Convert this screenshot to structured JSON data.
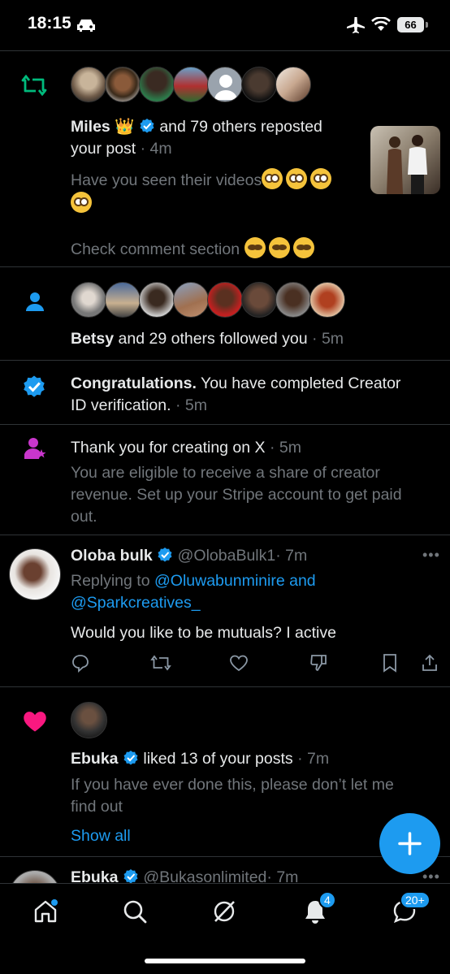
{
  "status_bar": {
    "time": "18:15",
    "battery": "66"
  },
  "notifications": {
    "repost": {
      "name": "Miles",
      "name_suffix": "👑",
      "action": "and 79 others reposted",
      "line2": "your post",
      "time": "· 4m",
      "snippet_line1": "Have you seen their videos",
      "snippet_line2": "Check comment section"
    },
    "follow": {
      "name": "Betsy",
      "action": "and 29 others followed you",
      "time": "· 5m"
    },
    "verification": {
      "title": "Congratulations.",
      "text_line1": " You have completed Creator",
      "text_line2": "ID verification.",
      "time": "· 5m"
    },
    "creator": {
      "title": "Thank you for creating on X",
      "time": "· 5m",
      "line1": "You are eligible to receive a share of creator",
      "line2": "revenue. Set up your Stripe account to get paid",
      "line3": "out."
    },
    "reply": {
      "name": "Oloba bulk",
      "handle": "@OlobaBulk1",
      "time": "· 7m",
      "replying_to_label": "Replying to",
      "replying_to_1": "@Oluwabunminire and",
      "replying_to_2": "@Sparkcreatives_",
      "text": "Would you like to be mutuals? I active"
    },
    "like": {
      "name": "Ebuka",
      "action": "liked 13 of your posts",
      "time": "· 7m",
      "line1": "If you have ever done this, please don’t let me",
      "line2": "find out",
      "show_all": "Show all"
    },
    "partial": {
      "name": "Ebuka",
      "handle": "@Bukasonlimited",
      "time": "· 7m"
    }
  },
  "tabbar": {
    "notifications_badge": "4",
    "messages_badge": "20+"
  },
  "icons": [
    "car-icon",
    "airplane-icon",
    "wifi-icon",
    "repost-icon",
    "person-icon",
    "verified-icon",
    "creator-icon",
    "heart-icon",
    "reply-icon",
    "like-icon",
    "dislike-icon",
    "bookmark-icon",
    "share-icon",
    "home-icon",
    "search-icon",
    "grok-icon",
    "bell-icon",
    "messages-icon",
    "compose-icon"
  ],
  "colors": {
    "accent": "#1d9bf0",
    "repost": "#00ba7c",
    "like": "#f91880",
    "creator": "#c936cc"
  }
}
